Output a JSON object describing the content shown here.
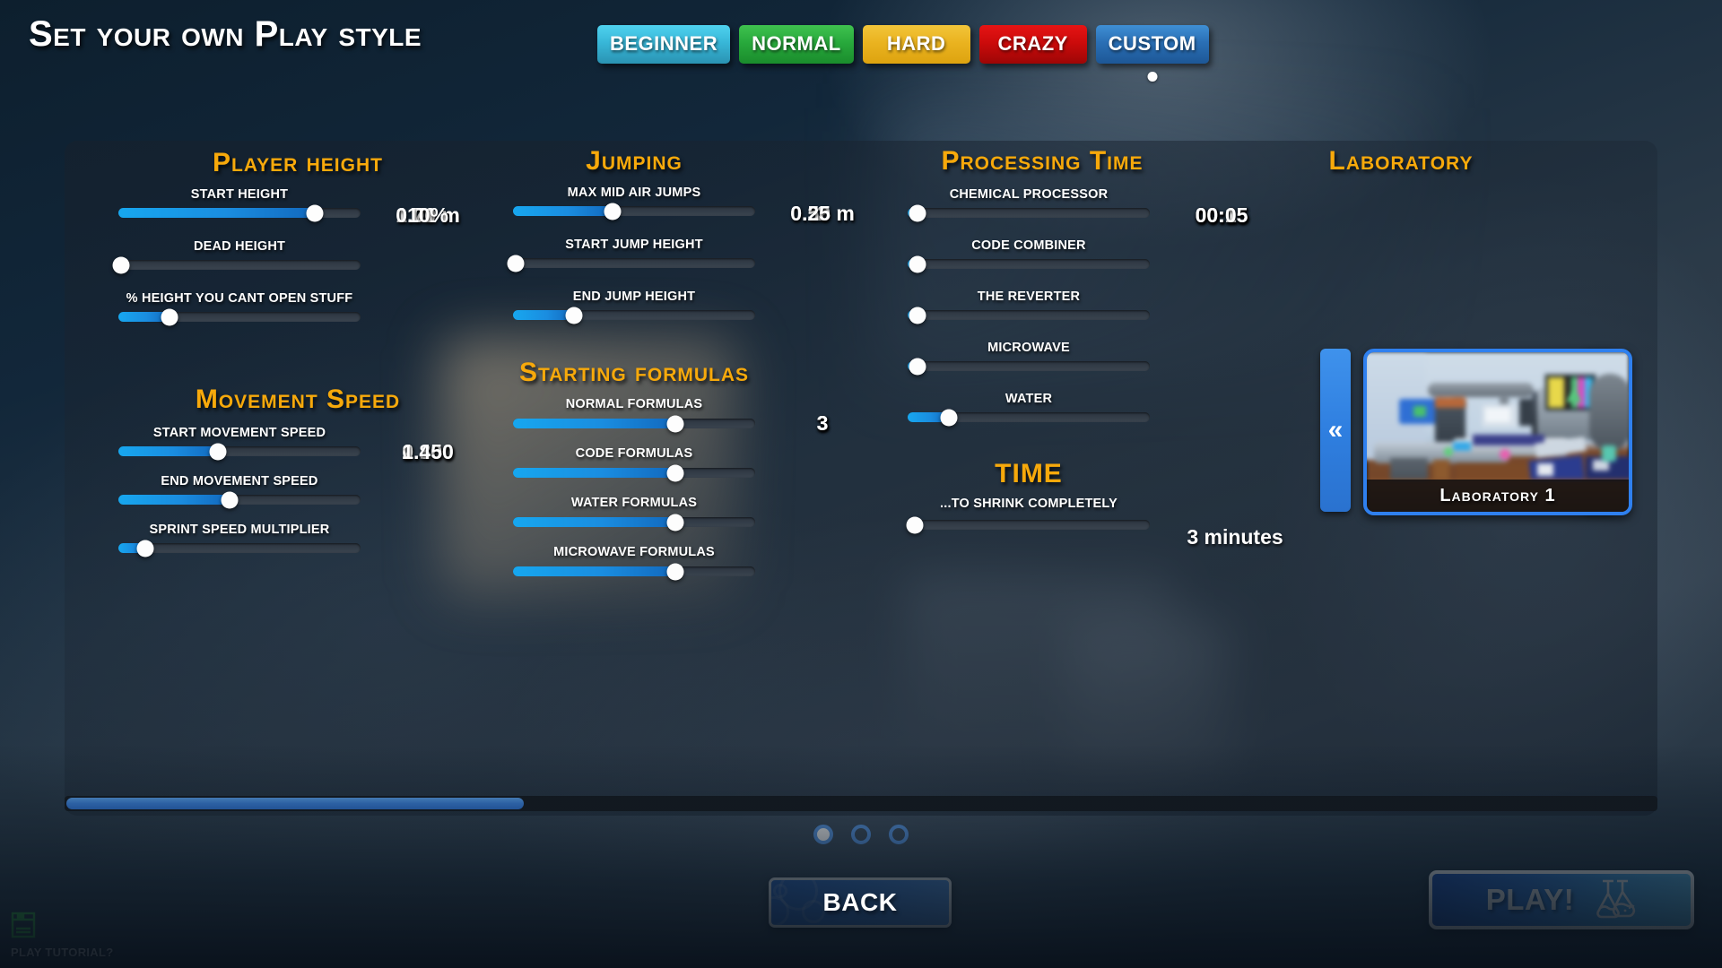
{
  "header": {
    "title": "Set your own Play style",
    "difficulties": [
      {
        "label": "BEGINNER",
        "key": "beginner",
        "selected": false
      },
      {
        "label": "NORMAL",
        "key": "normal",
        "selected": false
      },
      {
        "label": "HARD",
        "key": "hard",
        "selected": false
      },
      {
        "label": "CRAZY",
        "key": "crazy",
        "selected": false
      },
      {
        "label": "CUSTOM",
        "key": "custom",
        "selected": true
      }
    ]
  },
  "sections": {
    "player_height": {
      "title": "Player height",
      "sliders": [
        {
          "label": "START HEIGHT",
          "value": "1.70 m",
          "pct": 81
        },
        {
          "label": "DEAD HEIGHT",
          "value": "0.01 m",
          "pct": 1
        },
        {
          "label": "% HEIGHT YOU CANT OPEN STUFF",
          "value": "10%",
          "pct": 21
        }
      ]
    },
    "movement_speed": {
      "title": "Movement Speed",
      "sliders": [
        {
          "label": "START MOVEMENT SPEED",
          "value": "2.100",
          "pct": 41
        },
        {
          "label": "END MOVEMENT SPEED",
          "value": "0.800",
          "pct": 46
        },
        {
          "label": "SPRINT SPEED MULTIPLIER",
          "value": "1.450",
          "pct": 11
        }
      ]
    },
    "jumping": {
      "title": "Jumping",
      "sliders": [
        {
          "label": "MAX MID AIR JUMPS",
          "value": "2",
          "pct": 41
        },
        {
          "label": "START JUMP HEIGHT",
          "value": "0.50 m",
          "pct": 1
        },
        {
          "label": "END JUMP HEIGHT",
          "value": "0.25 m",
          "pct": 25
        }
      ]
    },
    "starting_formulas": {
      "title": "Starting formulas",
      "sliders": [
        {
          "label": "NORMAL FORMULAS",
          "value": "3",
          "pct": 67
        },
        {
          "label": "CODE FORMULAS",
          "value": "3",
          "pct": 67
        },
        {
          "label": "WATER FORMULAS",
          "value": "3",
          "pct": 67
        },
        {
          "label": "MICROWAVE FORMULAS",
          "value": "3",
          "pct": 67
        }
      ]
    },
    "processing_time": {
      "title": "Processing Time",
      "sliders": [
        {
          "label": "CHEMICAL PROCESSOR",
          "value": "00:15",
          "pct": 4
        },
        {
          "label": "CODE COMBINER",
          "value": "00:15",
          "pct": 4
        },
        {
          "label": "THE REVERTER",
          "value": "00:15",
          "pct": 4
        },
        {
          "label": "MICROWAVE",
          "value": "00:15",
          "pct": 4
        },
        {
          "label": "WATER",
          "value": "00:05",
          "pct": 17
        }
      ]
    },
    "time": {
      "title": "TIME",
      "subtitle": "...TO SHRINK COMPLETELY",
      "sliders": [
        {
          "label": "",
          "value": "3 minutes",
          "pct": 3
        }
      ]
    },
    "laboratory": {
      "title": "Laboratory",
      "prev_icon": "chevron-double-left-icon",
      "next_icon": "chevron-double-right-icon",
      "prev_glyph": "«",
      "next_glyph": "»",
      "caption": "Laboratory 1"
    }
  },
  "footer": {
    "pages": [
      {
        "active": true
      },
      {
        "active": false
      },
      {
        "active": false
      }
    ],
    "back_label": "BACK",
    "play_label": "PLAY!",
    "tutorial_label": "PLAY TUTORIAL?",
    "scroll_thumb_pct": 29
  },
  "colors": {
    "accent_orange": "#f7a90b",
    "slider_blue": "#17a7ef",
    "button_blue": "#2f7fe0",
    "tutorial_green": "#3fd14a"
  }
}
